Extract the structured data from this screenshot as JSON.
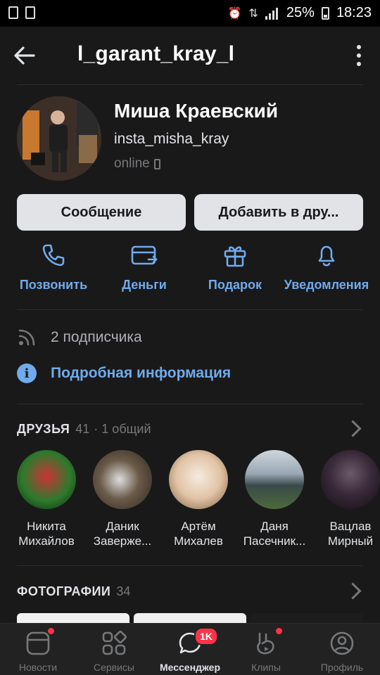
{
  "status_bar": {
    "battery": "25%",
    "time": "18:23"
  },
  "header": {
    "title": "l_garant_kray_l"
  },
  "profile": {
    "name": "Миша Краевский",
    "status": "insta_misha_kray",
    "online": "online"
  },
  "buttons": {
    "message": "Сообщение",
    "add_friend": "Добавить в дру..."
  },
  "actions": {
    "call": "Позвонить",
    "money": "Деньги",
    "gift": "Подарок",
    "notifications": "Уведомления"
  },
  "followers": "2 подписчика",
  "details": "Подробная информация",
  "friends_section": {
    "title": "ДРУЗЬЯ",
    "count": "41",
    "common": "· 1 общий",
    "items": [
      {
        "first": "Никита",
        "last": "Михайлов",
        "color": "#3a7a2a"
      },
      {
        "first": "Даник",
        "last": "Заверже...",
        "color": "#5a4a3a"
      },
      {
        "first": "Артём",
        "last": "Михалев",
        "color": "#d9b9a0"
      },
      {
        "first": "Даня",
        "last": "Пасечник...",
        "color": "#4a5a4a"
      },
      {
        "first": "Вацлав",
        "last": "Мирный",
        "color": "#3a2a3a"
      }
    ]
  },
  "photos_section": {
    "title": "ФОТОГРАФИИ",
    "count": "34"
  },
  "tabbar": {
    "news": "Новости",
    "services": "Сервисы",
    "messenger": "Мессенджер",
    "messenger_badge": "1K",
    "clips": "Клипы",
    "profile": "Профиль"
  },
  "colors": {
    "accent": "#71aaeb",
    "background": "#19191a",
    "badge": "#ff3347"
  }
}
